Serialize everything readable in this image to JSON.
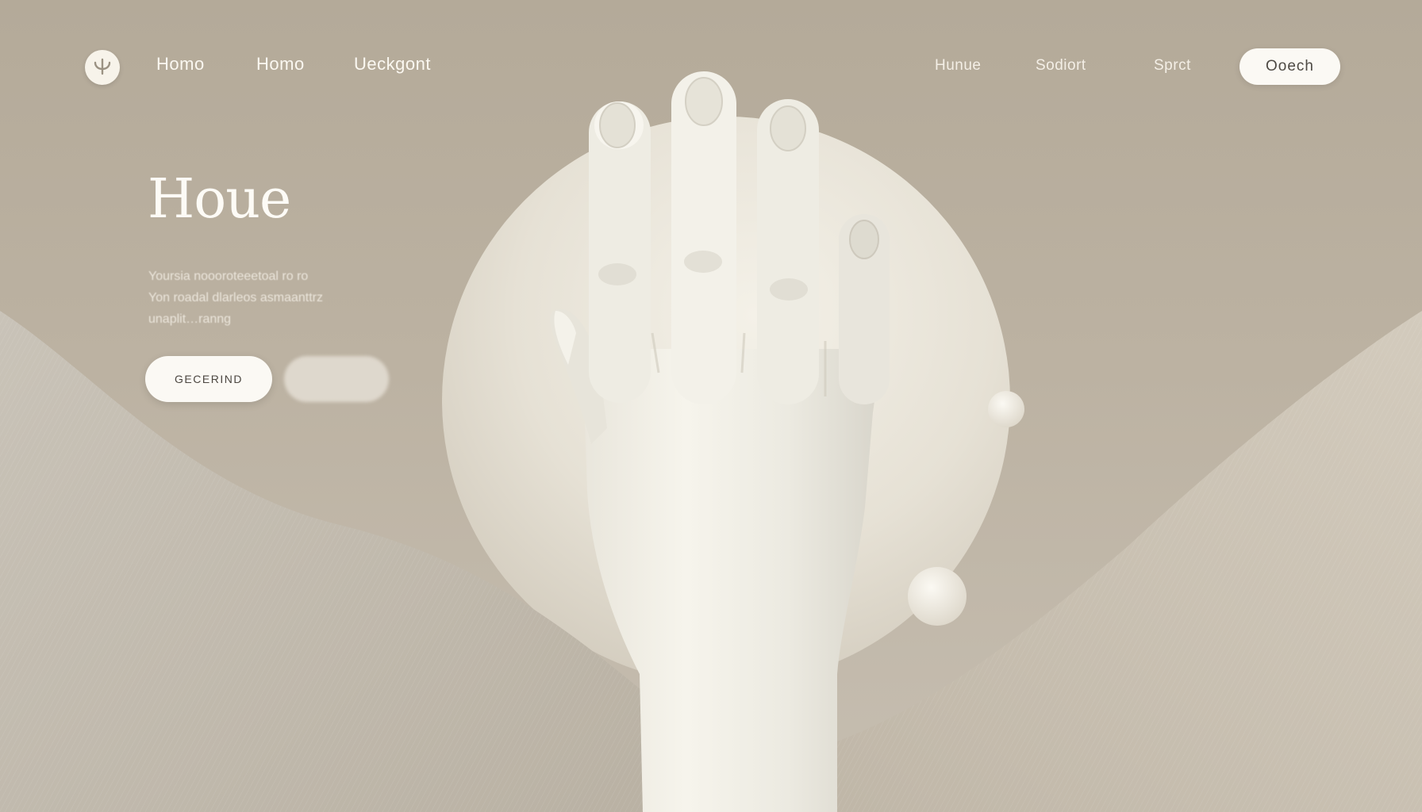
{
  "nav": {
    "left_links": [
      "Homo",
      "Homo",
      "Ueckgont"
    ],
    "right_links": [
      "Hunue",
      "Sodiort",
      "Sprct"
    ],
    "cta_label": "Ooech",
    "logo_icon": "leaf-logo-icon"
  },
  "hero": {
    "title": "Houe",
    "description_lines": [
      "Yoursia noooroteeetoal ro ro",
      "Yon roadal dlarleos asmaanttrz",
      "unaplit…ranng"
    ],
    "primary_button_label": "GECERIND",
    "secondary_button_label": ""
  },
  "colors": {
    "background": "#b8ad9d",
    "sun_disc": "#ebe7dc",
    "hand": "#f2efe6",
    "button": "#fbf9f4",
    "text_light": "#fdfbf6"
  }
}
